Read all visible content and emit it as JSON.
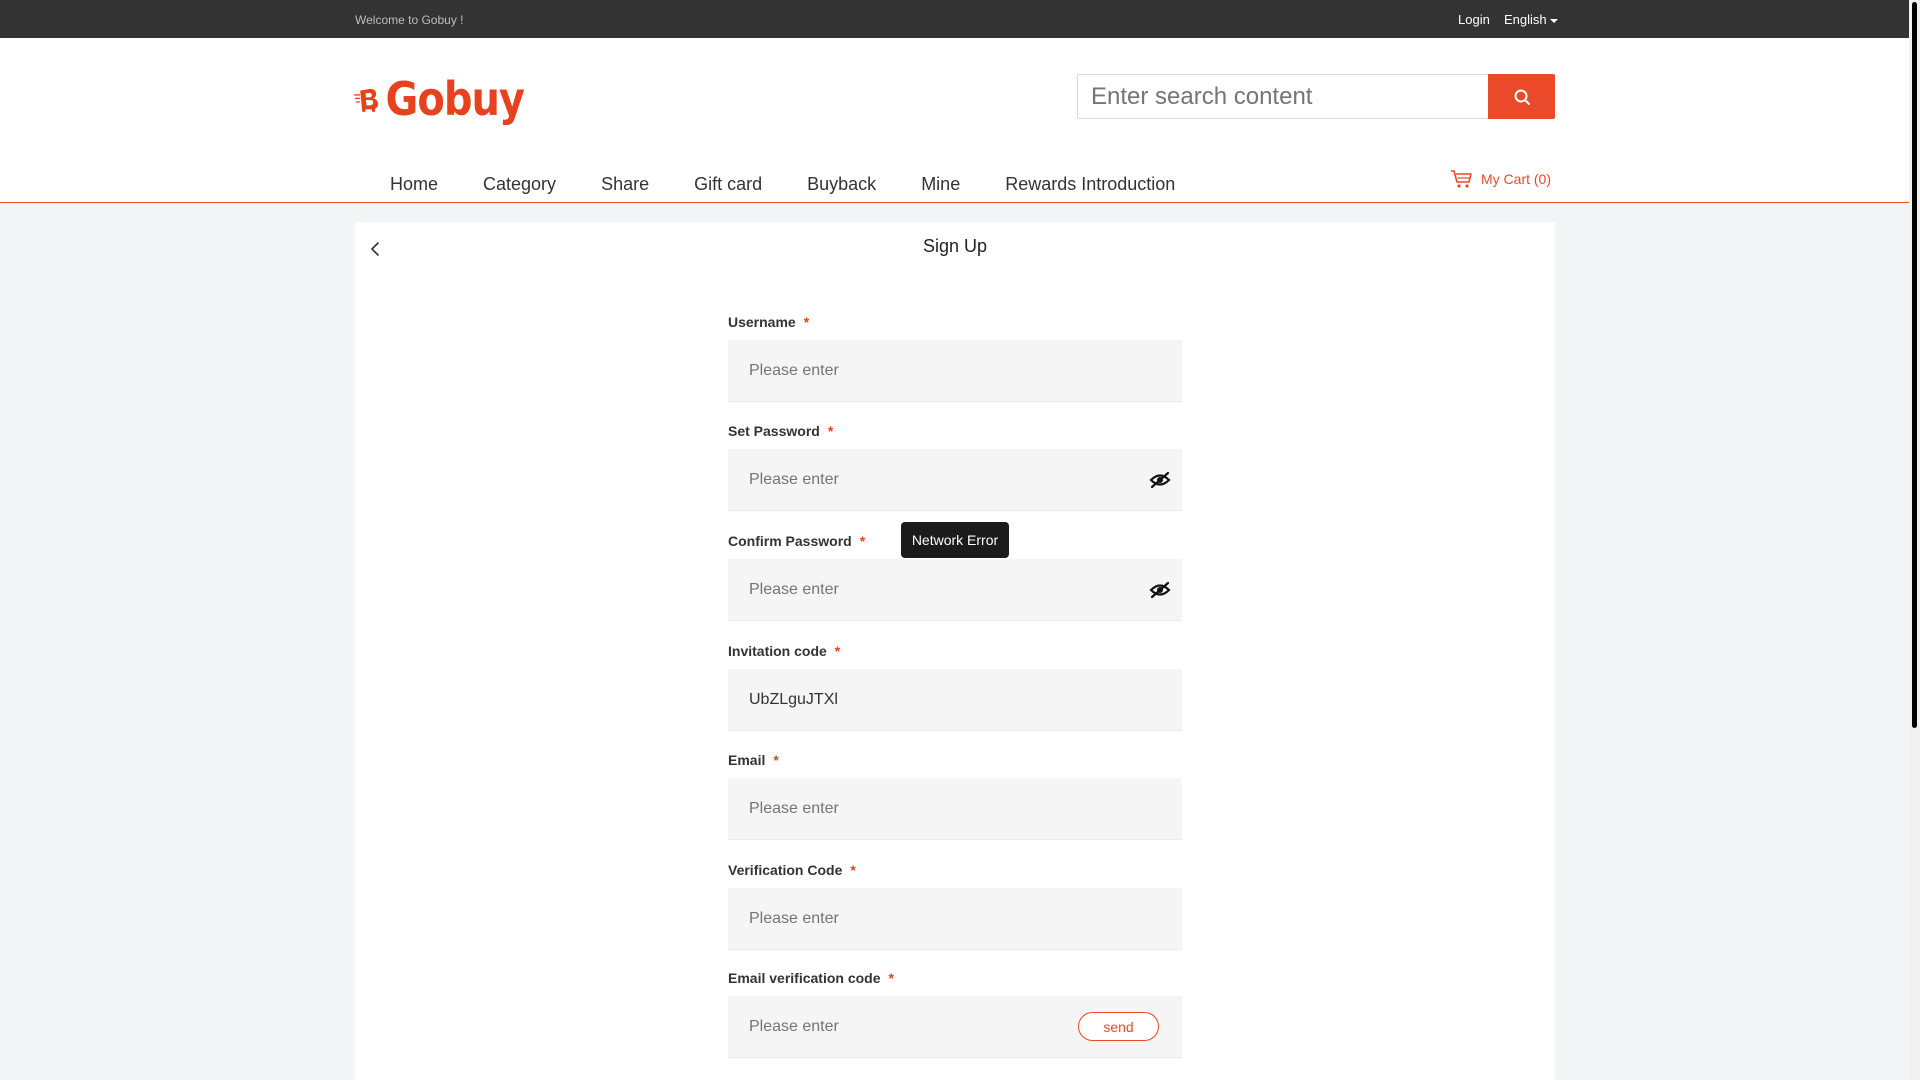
{
  "topbar": {
    "welcome": "Welcome to Gobuy !",
    "login": "Login",
    "language": "English"
  },
  "header": {
    "logo_text": "Gobuy",
    "search_placeholder": "Enter search content",
    "nav": [
      "Home",
      "Category",
      "Share",
      "Gift card",
      "Buyback",
      "Mine",
      "Rewards Introduction"
    ],
    "cart": "My Cart (0)"
  },
  "colors": {
    "accent": "#ea4a2a",
    "topbar": "#333333",
    "background": "#f3f4f6"
  },
  "signup": {
    "title": "Sign Up",
    "required_mark": "*",
    "fields": [
      {
        "label": "Username",
        "placeholder": "Please enter",
        "value": ""
      },
      {
        "label": "Set Password",
        "placeholder": "Please enter",
        "value": ""
      },
      {
        "label": "Confirm Password",
        "placeholder": "Please enter",
        "value": ""
      },
      {
        "label": "Invitation code",
        "placeholder": "Please enter",
        "value": "UbZLguJTXl"
      },
      {
        "label": "Email",
        "placeholder": "Please enter",
        "value": ""
      },
      {
        "label": "Verification Code",
        "placeholder": "Please enter",
        "value": ""
      },
      {
        "label": "Email verification code",
        "placeholder": "Please enter",
        "value": ""
      }
    ],
    "send_label": "send"
  },
  "toast": "Network Error",
  "icons": [
    "search-icon",
    "cart-icon",
    "back-arrow-icon",
    "eye-off-icon",
    "chevron-down-icon"
  ]
}
